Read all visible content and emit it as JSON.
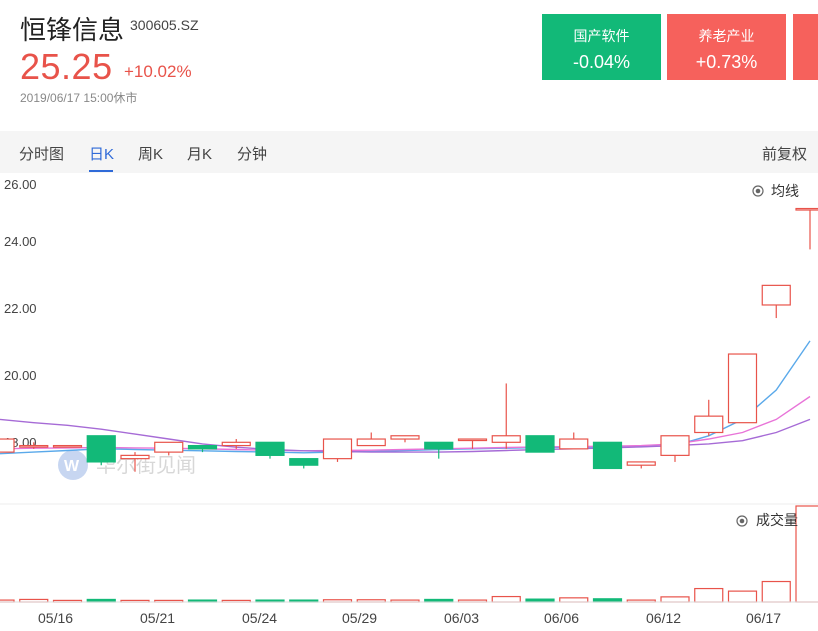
{
  "stock": {
    "name": "恒锋信息",
    "code": "300605.SZ",
    "price": "25.25",
    "change": "+10.02%",
    "timestamp": "2019/06/17  15:00休市"
  },
  "sectors": [
    {
      "name": "国产软件",
      "change": "-0.04%"
    },
    {
      "name": "养老产业",
      "change": "+0.73%"
    }
  ],
  "tabs": [
    "分时图",
    "日K",
    "周K",
    "月K",
    "分钟"
  ],
  "active_tab": "日K",
  "adjust_label": "前复权",
  "ma_toggle_label": "均线",
  "volume_toggle_label": "成交量",
  "watermark": "华尔街见闻",
  "colors": {
    "up": "#e8534a",
    "down": "#12b978",
    "accent": "#2f6ad8"
  },
  "chart_data": {
    "type": "candlestick",
    "ylim": [
      17.1,
      26.0
    ],
    "y_ticks": [
      "26.00",
      "24.00",
      "22.00",
      "20.00",
      "18.00"
    ],
    "x_ticks": [
      "05/16",
      "05/21",
      "05/24",
      "05/29",
      "06/03",
      "06/06",
      "06/12",
      "06/17"
    ],
    "candles": [
      {
        "o": 17.8,
        "c": 18.2,
        "h": 18.2,
        "l": 17.8
      },
      {
        "o": 18.0,
        "c": 18.0,
        "h": 18.1,
        "l": 17.9
      },
      {
        "o": 18.0,
        "c": 18.0,
        "h": 18.0,
        "l": 18.0
      },
      {
        "o": 18.3,
        "c": 17.5,
        "h": 18.3,
        "l": 17.4
      },
      {
        "o": 17.6,
        "c": 17.7,
        "h": 17.8,
        "l": 17.2
      },
      {
        "o": 17.8,
        "c": 18.1,
        "h": 18.1,
        "l": 17.7
      },
      {
        "o": 18.0,
        "c": 17.9,
        "h": 18.0,
        "l": 17.8
      },
      {
        "o": 18.0,
        "c": 18.1,
        "h": 18.2,
        "l": 17.9
      },
      {
        "o": 18.1,
        "c": 17.7,
        "h": 18.1,
        "l": 17.6
      },
      {
        "o": 17.6,
        "c": 17.4,
        "h": 17.6,
        "l": 17.3
      },
      {
        "o": 17.6,
        "c": 18.2,
        "h": 18.2,
        "l": 17.5
      },
      {
        "o": 18.0,
        "c": 18.2,
        "h": 18.4,
        "l": 18.0
      },
      {
        "o": 18.2,
        "c": 18.3,
        "h": 18.3,
        "l": 18.1
      },
      {
        "o": 18.1,
        "c": 17.9,
        "h": 18.1,
        "l": 17.6
      },
      {
        "o": 18.2,
        "c": 18.2,
        "h": 18.2,
        "l": 17.9
      },
      {
        "o": 18.1,
        "c": 18.3,
        "h": 19.9,
        "l": 17.9
      },
      {
        "o": 18.3,
        "c": 17.8,
        "h": 18.3,
        "l": 17.8
      },
      {
        "o": 17.9,
        "c": 18.2,
        "h": 18.4,
        "l": 17.9
      },
      {
        "o": 18.1,
        "c": 17.3,
        "h": 18.1,
        "l": 17.3
      },
      {
        "o": 17.4,
        "c": 17.5,
        "h": 17.5,
        "l": 17.3
      },
      {
        "o": 17.7,
        "c": 18.3,
        "h": 18.3,
        "l": 17.5
      },
      {
        "o": 18.4,
        "c": 18.9,
        "h": 19.4,
        "l": 18.3
      },
      {
        "o": 18.7,
        "c": 20.8,
        "h": 20.8,
        "l": 18.7
      },
      {
        "o": 22.3,
        "c": 22.9,
        "h": 22.9,
        "l": 21.9
      },
      {
        "o": 25.25,
        "c": 25.25,
        "h": 25.25,
        "l": 24.0
      }
    ],
    "ma_lines": [
      {
        "color": "#5aa9ea",
        "values": [
          17.75,
          17.8,
          17.85,
          17.9,
          17.88,
          17.86,
          17.84,
          17.82,
          17.8,
          17.78,
          17.8,
          17.82,
          17.85,
          17.88,
          17.9,
          17.92,
          17.94,
          17.95,
          17.96,
          17.97,
          18.0,
          18.3,
          18.8,
          19.7,
          21.2
        ]
      },
      {
        "color": "#e874d8",
        "values": [
          17.9,
          17.92,
          17.93,
          17.94,
          17.93,
          17.92,
          17.9,
          17.88,
          17.86,
          17.84,
          17.85,
          17.86,
          17.88,
          17.9,
          17.92,
          17.94,
          17.96,
          17.97,
          17.98,
          18.0,
          18.05,
          18.2,
          18.4,
          18.8,
          19.5
        ]
      },
      {
        "color": "#a66bd6",
        "values": [
          18.8,
          18.7,
          18.62,
          18.5,
          18.35,
          18.2,
          18.05,
          17.95,
          17.88,
          17.84,
          17.82,
          17.8,
          17.8,
          17.8,
          17.82,
          17.85,
          17.88,
          17.9,
          17.93,
          17.96,
          18.0,
          18.05,
          18.15,
          18.4,
          18.8
        ]
      }
    ],
    "volume": {
      "max": 30,
      "values": [
        0.6,
        0.8,
        0.5,
        0.8,
        0.5,
        0.5,
        0.6,
        0.5,
        0.6,
        0.6,
        0.7,
        0.7,
        0.6,
        0.8,
        0.6,
        1.7,
        0.9,
        1.3,
        1.0,
        0.6,
        1.6,
        4.2,
        3.4,
        6.4,
        30
      ]
    }
  }
}
